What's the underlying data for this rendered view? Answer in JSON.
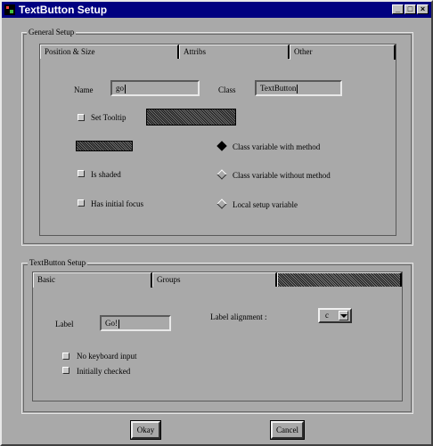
{
  "window": {
    "title": "TextButton Setup",
    "controls": {
      "minimize": "_",
      "maximize": "□",
      "close": "×"
    }
  },
  "general": {
    "title": "General Setup",
    "tabs": [
      {
        "label": "Position & Size",
        "active": false
      },
      {
        "label": "Attribs",
        "active": false
      },
      {
        "label": "Other",
        "active": true
      }
    ],
    "name_label": "Name",
    "name_value": "go",
    "class_label": "Class",
    "class_value": "TextButton",
    "set_tooltip": "Set Tooltip",
    "is_shaded": "Is shaded",
    "has_initial_focus": "Has initial focus",
    "radio_options": [
      {
        "label": "Class variable with method",
        "selected": true
      },
      {
        "label": "Class variable without method",
        "selected": false
      },
      {
        "label": "Local setup variable",
        "selected": false
      }
    ]
  },
  "textbutton": {
    "title": "TextButton Setup",
    "tabs": [
      {
        "label": "Basic",
        "active": true
      },
      {
        "label": "Groups",
        "active": false
      },
      {
        "label": "",
        "active": false
      }
    ],
    "label_label": "Label",
    "label_value": "Go!",
    "alignment_label": "Label alignment :",
    "alignment_value": "c",
    "no_keyboard_input": "No keyboard input",
    "initially_checked": "Initially checked"
  },
  "buttons": {
    "okay": "Okay",
    "cancel": "Cancel"
  }
}
